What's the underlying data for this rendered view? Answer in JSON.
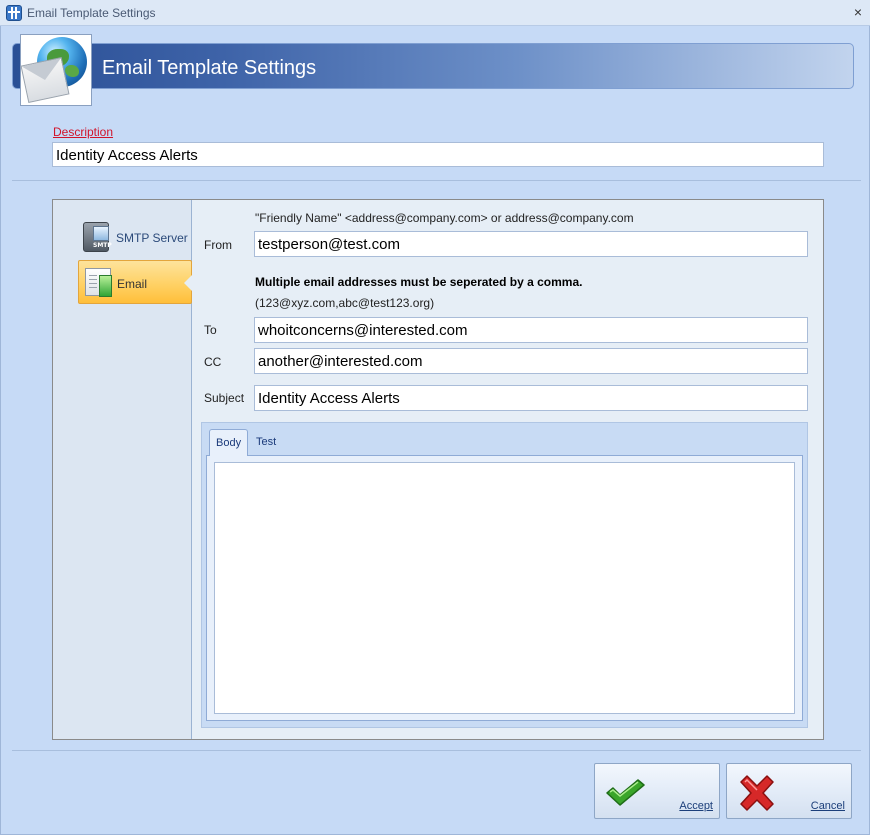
{
  "window": {
    "title": "Email Template Settings",
    "close_glyph": "×"
  },
  "header": {
    "title": "Email Template Settings",
    "icon": "globe-envelope-icon"
  },
  "description": {
    "label": "Description",
    "value": "Identity Access Alerts"
  },
  "nav": {
    "items": [
      {
        "label": "SMTP Server",
        "icon": "smtp-server-icon",
        "selected": false
      },
      {
        "label": "Email",
        "icon": "email-icon",
        "selected": true
      }
    ]
  },
  "form": {
    "from_hint": "\"Friendly Name\" <address@company.com> or address@company.com",
    "from_label": "From",
    "from_value": "testperson@test.com",
    "multi_hint": "Multiple email addresses must be seperated by a comma.",
    "multi_example": "(123@xyz.com,abc@test123.org)",
    "to_label": "To",
    "to_value": "whoitconcerns@interested.com",
    "cc_label": "CC",
    "cc_value": "another@interested.com",
    "subject_label": "Subject",
    "subject_value": "Identity Access Alerts"
  },
  "tabs": [
    {
      "label": "Body",
      "active": true
    },
    {
      "label": "Test",
      "active": false
    }
  ],
  "body_text": "",
  "buttons": {
    "accept": "Accept",
    "cancel": "Cancel"
  },
  "colors": {
    "accent_banner": "#2a4f95",
    "selected_nav": "#ffd36a",
    "required_label": "#d1132a",
    "accept_check": "#3aa52a",
    "cancel_x": "#d62828"
  }
}
